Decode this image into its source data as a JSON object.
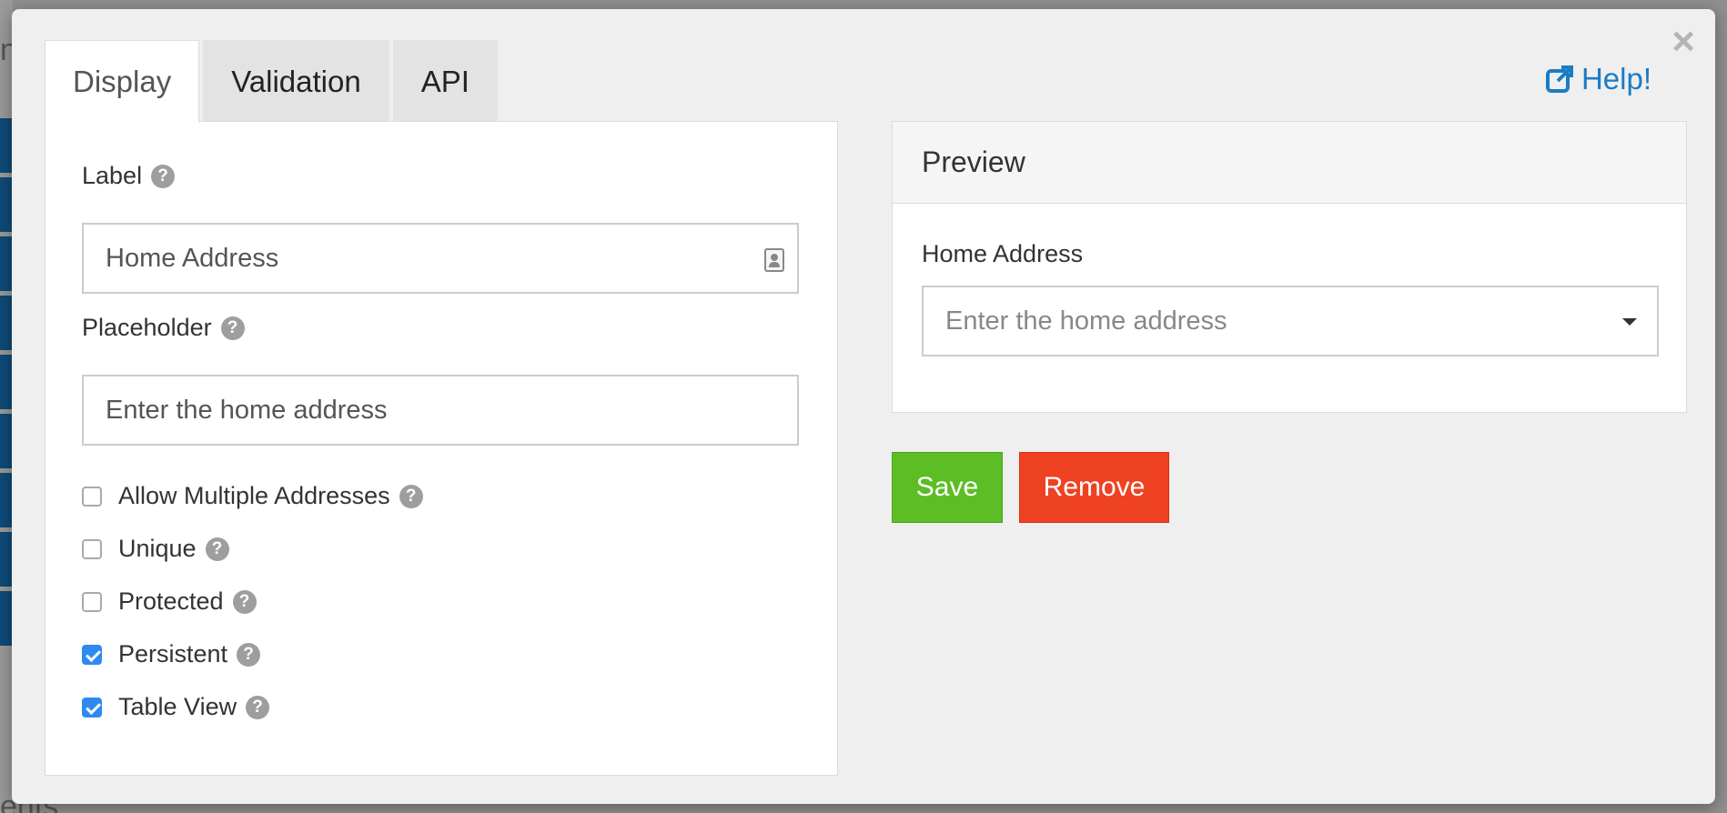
{
  "background": {
    "fragment_top": "n",
    "fragment_bottom": "ents"
  },
  "modal": {
    "close_glyph": "×",
    "help_label": "Help!",
    "tabs": [
      {
        "label": "Display",
        "active": true
      },
      {
        "label": "Validation",
        "active": false
      },
      {
        "label": "API",
        "active": false
      }
    ],
    "display": {
      "label_field": {
        "label": "Label",
        "value": "Home Address"
      },
      "placeholder_field": {
        "label": "Placeholder",
        "value": "Enter the home address"
      },
      "checkboxes": [
        {
          "label": "Allow Multiple Addresses",
          "checked": false
        },
        {
          "label": "Unique",
          "checked": false
        },
        {
          "label": "Protected",
          "checked": false
        },
        {
          "label": "Persistent",
          "checked": true
        },
        {
          "label": "Table View",
          "checked": true
        }
      ]
    },
    "preview": {
      "title": "Preview",
      "field_label": "Home Address",
      "select_placeholder": "Enter the home address"
    },
    "buttons": {
      "save": "Save",
      "remove": "Remove"
    }
  },
  "colors": {
    "save": "#5cbd24",
    "remove": "#ef4223",
    "link": "#1b7cc4",
    "checkbox_checked": "#2d8af0"
  },
  "icons": {
    "help_q": "?",
    "external_link": "external-link-icon",
    "contact_card": "contact-card-icon"
  }
}
